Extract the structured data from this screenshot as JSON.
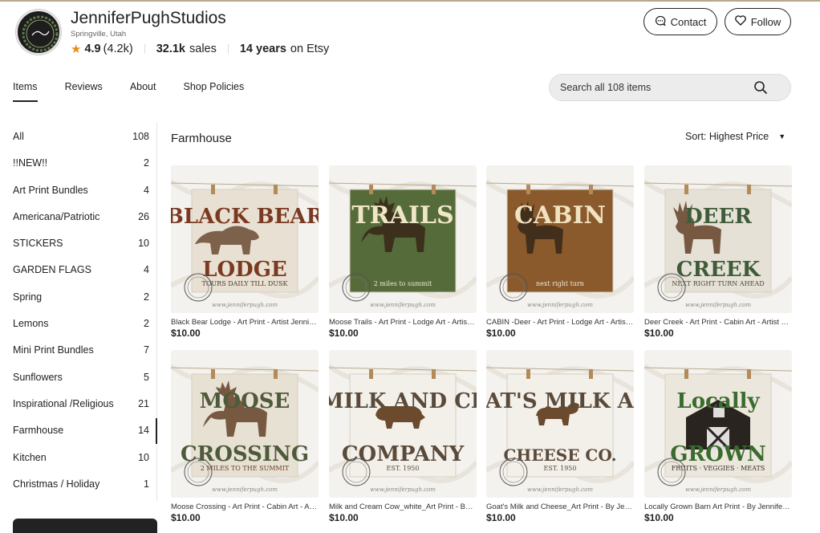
{
  "shop": {
    "name": "JenniferPughStudios",
    "location": "Springville, Utah",
    "rating": "4.9",
    "rating_count": "(4.2k)",
    "sales_count": "32.1k",
    "sales_label": "sales",
    "years_count": "14 years",
    "years_label": "on Etsy"
  },
  "actions": {
    "contact_label": "Contact",
    "follow_label": "Follow"
  },
  "tabs": [
    {
      "label": "Items",
      "active": true
    },
    {
      "label": "Reviews"
    },
    {
      "label": "About"
    },
    {
      "label": "Shop Policies"
    }
  ],
  "search": {
    "placeholder": "Search all 108 items"
  },
  "sidebar": {
    "items": [
      {
        "label": "All",
        "count": "108"
      },
      {
        "label": "!!NEW!!",
        "count": "2"
      },
      {
        "label": "Art Print Bundles",
        "count": "4"
      },
      {
        "label": "Americana/Patriotic",
        "count": "26"
      },
      {
        "label": "STICKERS",
        "count": "10"
      },
      {
        "label": "GARDEN FLAGS",
        "count": "4"
      },
      {
        "label": "Spring",
        "count": "2"
      },
      {
        "label": "Lemons",
        "count": "2"
      },
      {
        "label": "Mini Print Bundles",
        "count": "7"
      },
      {
        "label": "Sunflowers",
        "count": "5"
      },
      {
        "label": "Inspirational /Religious",
        "count": "21"
      },
      {
        "label": "Farmhouse",
        "count": "14"
      },
      {
        "label": "Kitchen",
        "count": "10"
      },
      {
        "label": "Christmas / Holiday",
        "count": "1"
      }
    ]
  },
  "section": {
    "title": "Farmhouse",
    "sort_label": "Sort: Highest Price"
  },
  "listings": [
    {
      "title": "Black Bear Lodge - Art Print - Artist Jennifer Pugh",
      "price": "$10.00",
      "art": {
        "line1": "BLACK BEAR",
        "line2": "LODGE",
        "sub": "TOURS DAILY TILL DUSK"
      }
    },
    {
      "title": "Moose Trails - Art Print - Lodge Art - Artist Jennifer Pugh",
      "price": "$10.00",
      "art": {
        "line1": "TRAILS",
        "line2": "",
        "sub": "2 miles to summit"
      }
    },
    {
      "title": "CABIN -Deer - Art Print - Lodge Art - Artist Jennifer Pugh",
      "price": "$10.00",
      "art": {
        "line1": "CABIN",
        "line2": "",
        "sub": "next right turn"
      }
    },
    {
      "title": "Deer Creek - Art Print - Cabin Art - Artist Jennifer Pugh",
      "price": "$10.00",
      "art": {
        "line1": "DEER",
        "line2": "CREEK",
        "sub": "NEXT RIGHT TURN AHEAD"
      }
    },
    {
      "title": "Moose Crossing - Art Print - Cabin Art - Artist Jennifer Pugh",
      "price": "$10.00",
      "art": {
        "line1": "MOOSE",
        "line2": "CROSSING",
        "sub": "2 MILES TO THE SUMMIT"
      }
    },
    {
      "title": "Milk and Cream Cow_white_Art Print - By Jennifer Pugh",
      "price": "$10.00",
      "art": {
        "line1": "THE MILK AND CREAM",
        "line2": "COMPANY",
        "sub": "EST. 1950"
      }
    },
    {
      "title": "Goat's Milk and Cheese_Art Print - By Jennifer Pugh",
      "price": "$10.00",
      "art": {
        "line1": "GOAT'S MILK AND",
        "line2": "CHEESE CO.",
        "sub": "EST. 1950"
      }
    },
    {
      "title": "Locally Grown Barn Art Print - By Jennifer Pugh",
      "price": "$10.00",
      "art": {
        "line1": "Locally",
        "line2": "GROWN",
        "sub": "FRUITS · VEGGIES · MEATS"
      }
    }
  ],
  "watermark": "www.jenniferpugh.com",
  "colors": {
    "accent_star": "#e58c1a",
    "text": "#222222",
    "search_bg": "#ececec"
  }
}
